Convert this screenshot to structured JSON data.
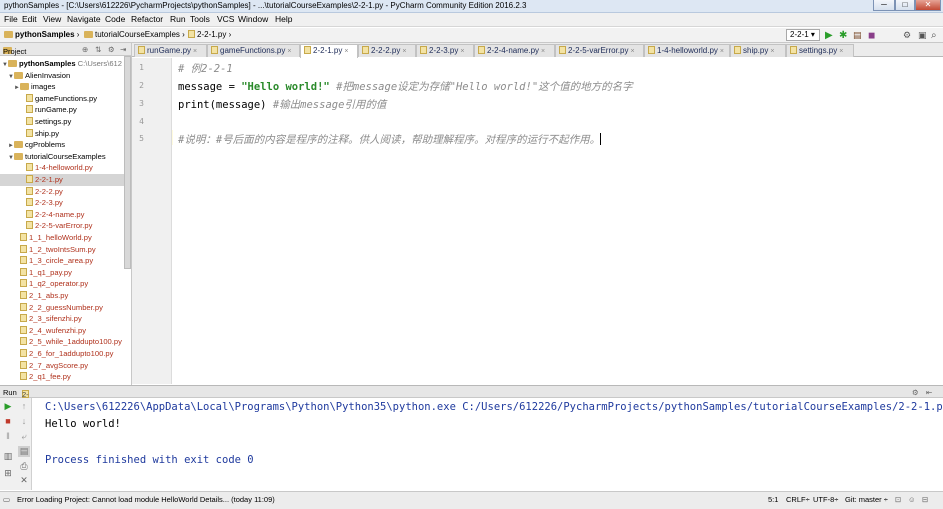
{
  "window": {
    "title": "pythonSamples - [C:\\Users\\612226\\PycharmProjects\\pythonSamples] - ...\\tutorialCourseExamples\\2-2-1.py - PyCharm Community Edition 2016.2.3",
    "minimize": "─",
    "maximize": "□",
    "close": "✕"
  },
  "menu": [
    "File",
    "Edit",
    "View",
    "Navigate",
    "Code",
    "Refactor",
    "Run",
    "Tools",
    "VCS",
    "Window",
    "Help"
  ],
  "breadcrumb": {
    "project": "pythonSamples",
    "folder": "tutorialCourseExamples",
    "file": "2-2-1.py"
  },
  "toolbar": {
    "run_config": "2-2-1",
    "run": "▶",
    "debug": "✱",
    "search": "⌕"
  },
  "project_panel": {
    "label": "Project",
    "tree": [
      {
        "label": "pythonSamples",
        "extra": "C:\\Users\\612",
        "kind": "root"
      },
      {
        "label": "AlienInvasion",
        "kind": "folder"
      },
      {
        "label": "images",
        "kind": "folder"
      },
      {
        "label": "gameFunctions.py",
        "kind": "file"
      },
      {
        "label": "runGame.py",
        "kind": "file"
      },
      {
        "label": "settings.py",
        "kind": "file"
      },
      {
        "label": "ship.py",
        "kind": "file"
      },
      {
        "label": "cgProblems",
        "kind": "folder"
      },
      {
        "label": "tutorialCourseExamples",
        "kind": "folder"
      },
      {
        "label": "1-4-helloworld.py",
        "kind": "file-red"
      },
      {
        "label": "2-2-1.py",
        "kind": "file-red"
      },
      {
        "label": "2-2-2.py",
        "kind": "file-red"
      },
      {
        "label": "2-2-3.py",
        "kind": "file-red"
      },
      {
        "label": "2-2-4-name.py",
        "kind": "file-red"
      },
      {
        "label": "2-2-5-varError.py",
        "kind": "file-red"
      },
      {
        "label": "1_1_helloWorld.py",
        "kind": "file-red"
      },
      {
        "label": "1_2_twoIntsSum.py",
        "kind": "file-red"
      },
      {
        "label": "1_3_circle_area.py",
        "kind": "file-red"
      },
      {
        "label": "1_q1_pay.py",
        "kind": "file-red"
      },
      {
        "label": "1_q2_operator.py",
        "kind": "file-red"
      },
      {
        "label": "2_1_abs.py",
        "kind": "file-red"
      },
      {
        "label": "2_2_guessNumber.py",
        "kind": "file-red"
      },
      {
        "label": "2_3_sifenzhi.py",
        "kind": "file-red"
      },
      {
        "label": "2_4_wufenzhi.py",
        "kind": "file-red"
      },
      {
        "label": "2_5_while_1addupto100.py",
        "kind": "file-red"
      },
      {
        "label": "2_6_for_1addupto100.py",
        "kind": "file-red"
      },
      {
        "label": "2_7_avgScore.py",
        "kind": "file-red"
      },
      {
        "label": "2_q1_fee.py",
        "kind": "file-red"
      }
    ]
  },
  "tabs": [
    {
      "label": "runGame.py"
    },
    {
      "label": "gameFunctions.py"
    },
    {
      "label": "2-2-1.py",
      "active": true
    },
    {
      "label": "2-2-2.py"
    },
    {
      "label": "2-2-3.py"
    },
    {
      "label": "2-2-4-name.py"
    },
    {
      "label": "2-2-5-varError.py"
    },
    {
      "label": "1-4-helloworld.py"
    },
    {
      "label": "ship.py"
    },
    {
      "label": "settings.py"
    }
  ],
  "editor": {
    "line_numbers": [
      "1",
      "2",
      "3",
      "4",
      "5"
    ],
    "line1_comment": "# 例2-2-1",
    "line2_code": "message = ",
    "line2_string": "\"Hello world!\"",
    "line2_comment": "#把message设定为存储\"Hello world!\"这个值的地方的名字",
    "line3_code": "print(message)",
    "line3_comment": "#输出message引用的值",
    "line5_comment": "#说明：#号后面的内容是程序的注释。供人阅读，帮助理解程序。对程序的运行不起作用。"
  },
  "run_panel": {
    "label": "Run",
    "config": "2-2-1",
    "command": "C:\\Users\\612226\\AppData\\Local\\Programs\\Python\\Python35\\python.exe C:/Users/612226/PycharmProjects/pythonSamples/tutorialCourseExamples/2-2-1.py",
    "output": "Hello world!",
    "exit": "Process finished with exit code 0"
  },
  "status": {
    "message": "Error Loading Project: Cannot load module HelloWorld Details... (today 11:09)",
    "position": "5:1",
    "line_sep": "CRLF÷",
    "encoding": "UTF-8÷",
    "vcs": "Git: master ÷"
  },
  "colors": {
    "accent_run": "#2a9d2a",
    "file_modified": "#b0321d",
    "comment": "#8c8c8c",
    "string": "#2a8a2a"
  }
}
